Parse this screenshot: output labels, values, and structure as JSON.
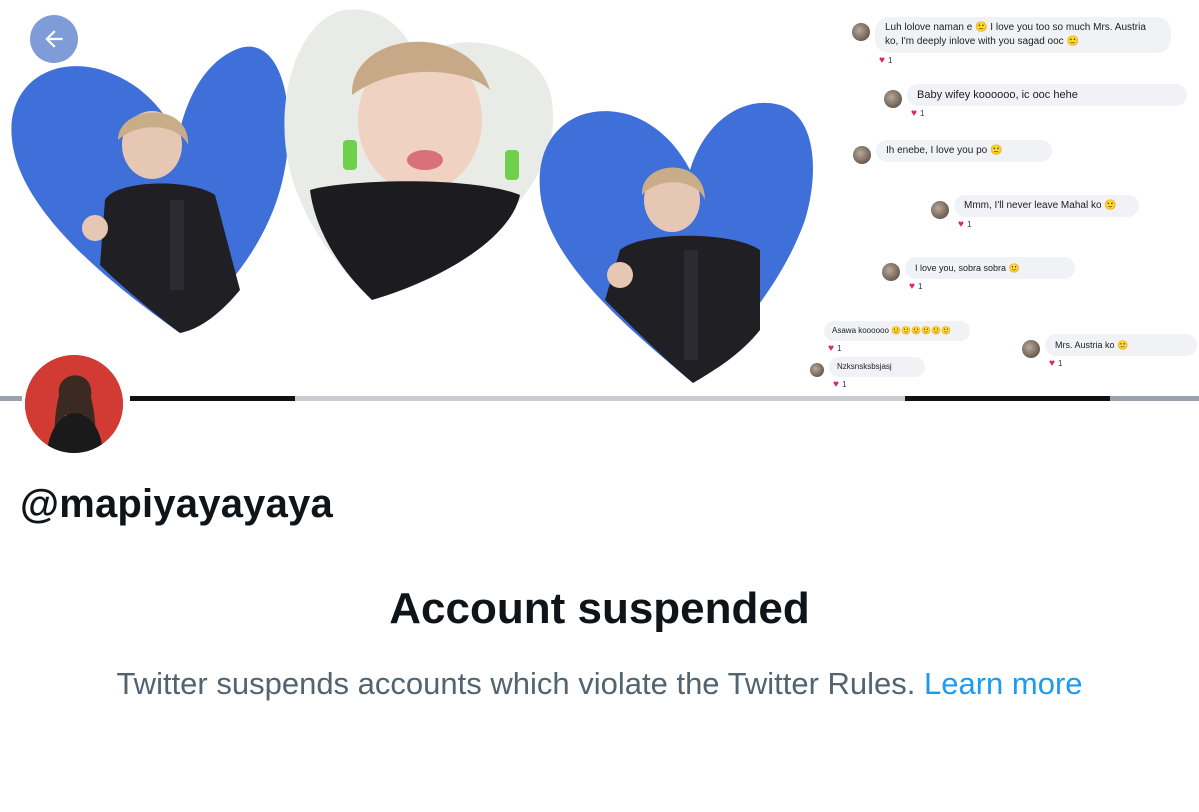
{
  "profile": {
    "handle": "@mapiyayayaya"
  },
  "banner": {
    "chats": [
      {
        "text": "Luh lolove naman e 🙂 I love you too so much Mrs. Austria ko, I'm deeply inlove with you sagad ooc 🙂",
        "reaction": "1"
      },
      {
        "text": "Baby wifey koooooo, ic ooc hehe",
        "reaction": "1"
      },
      {
        "text": "Ih enebe, I love you po 🙂",
        "reaction": ""
      },
      {
        "text": "Mmm, I'll never leave Mahal ko 🙂",
        "reaction": "1"
      },
      {
        "text": "I love you, sobra sobra 🙂",
        "reaction": "1"
      },
      {
        "text": "Asawa koooooo 🙂🙂🙂🙂🙂🙂",
        "reaction": "1"
      },
      {
        "text": "Mrs. Austria ko 🙂",
        "reaction": "1"
      },
      {
        "text": "Nzksnsksbsjasj",
        "reaction": "1"
      }
    ]
  },
  "suspension": {
    "title": "Account suspended",
    "message": "Twitter suspends accounts which violate the Twitter Rules.",
    "link_label": "Learn more"
  },
  "colors": {
    "link": "#1d9bf0",
    "muted": "#536471",
    "heart_bg": "#3f6fd8",
    "back_button": "#7f9bd8"
  }
}
